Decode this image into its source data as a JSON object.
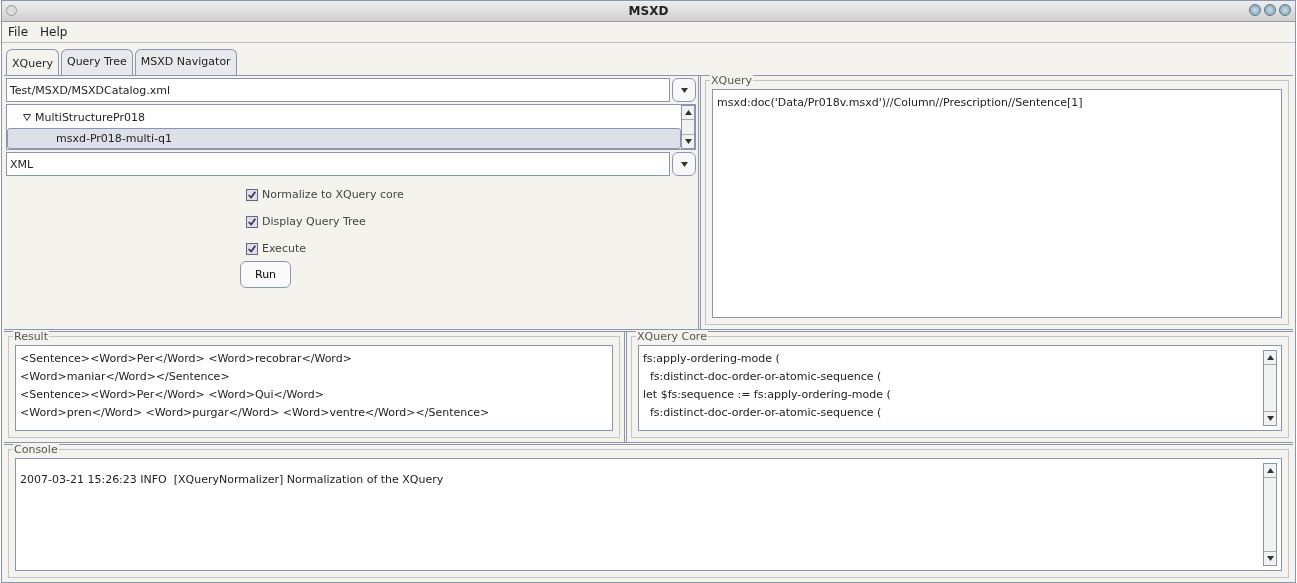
{
  "window": {
    "title": "MSXD"
  },
  "menu": [
    "File",
    "Help"
  ],
  "tabs": [
    {
      "label": "XQuery",
      "selected": true
    },
    {
      "label": "Query Tree",
      "selected": false
    },
    {
      "label": "MSXD Navigator",
      "selected": false
    }
  ],
  "catalog_combo": {
    "value": "Test/MSXD/MSXDCatalog.xml"
  },
  "tree": [
    {
      "label": "MultiStructurePr018",
      "expanded": true,
      "children": [
        {
          "label": "msxd-Pr018-multi-q1",
          "selected": true
        }
      ]
    }
  ],
  "format_combo": {
    "value": "XML"
  },
  "options": [
    {
      "label": "Normalize to XQuery core",
      "checked": true
    },
    {
      "label": "Display Query Tree",
      "checked": true
    },
    {
      "label": "Execute",
      "checked": true
    }
  ],
  "run_button": "Run",
  "xquery": {
    "title": "XQuery",
    "text": "msxd:doc('Data/Pr018v.msxd')//Column//Prescription//Sentence[1]"
  },
  "result": {
    "title": "Result",
    "lines": [
      "<Sentence><Word>Per</Word> <Word>recobrar</Word>",
      "<Word>maniar</Word></Sentence>",
      "<Sentence><Word>Per</Word> <Word>Qui</Word>",
      "<Word>pren</Word> <Word>purgar</Word> <Word>ventre</Word></Sentence>"
    ]
  },
  "xquery_core": {
    "title": "XQuery Core",
    "lines": [
      "fs:apply-ordering-mode (",
      "  fs:distinct-doc-order-or-atomic-sequence (",
      "let $fs:sequence := fs:apply-ordering-mode (",
      "  fs:distinct-doc-order-or-atomic-sequence ("
    ]
  },
  "console": {
    "title": "Console",
    "lines": [
      "2007-03-21 15:26:23 INFO  [XQueryNormalizer] Normalization of the XQuery"
    ]
  }
}
